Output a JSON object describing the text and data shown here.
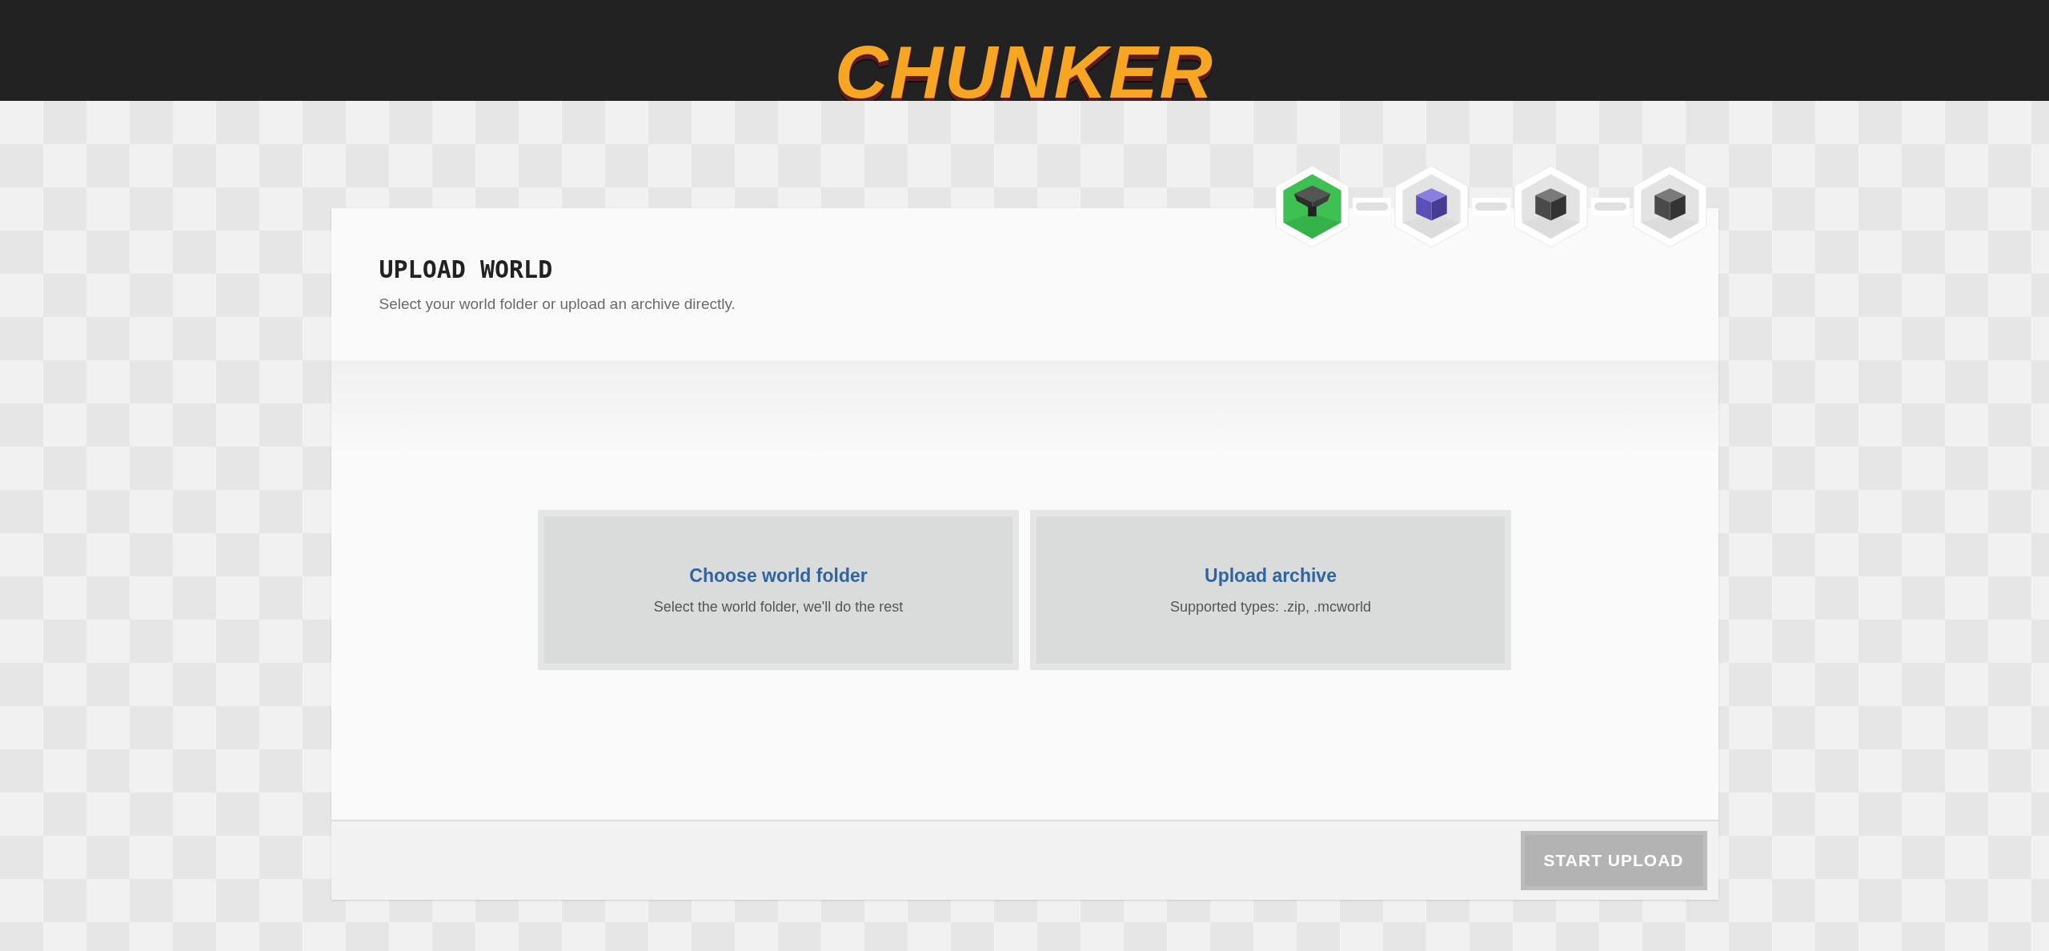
{
  "header": {
    "logo": "CHUNKER"
  },
  "steps": [
    {
      "selected": true
    },
    {
      "selected": false
    },
    {
      "selected": false
    },
    {
      "selected": false
    }
  ],
  "panel": {
    "title": "UPLOAD WORLD",
    "subtitle": "Select your world folder or upload an archive directly."
  },
  "options": [
    {
      "title": "Choose world folder",
      "description": "Select the world folder, we'll do the rest"
    },
    {
      "title": "Upload archive",
      "description": "Supported types: .zip, .mcworld"
    }
  ],
  "start_button": {
    "label": "START UPLOAD",
    "disabled": true
  }
}
